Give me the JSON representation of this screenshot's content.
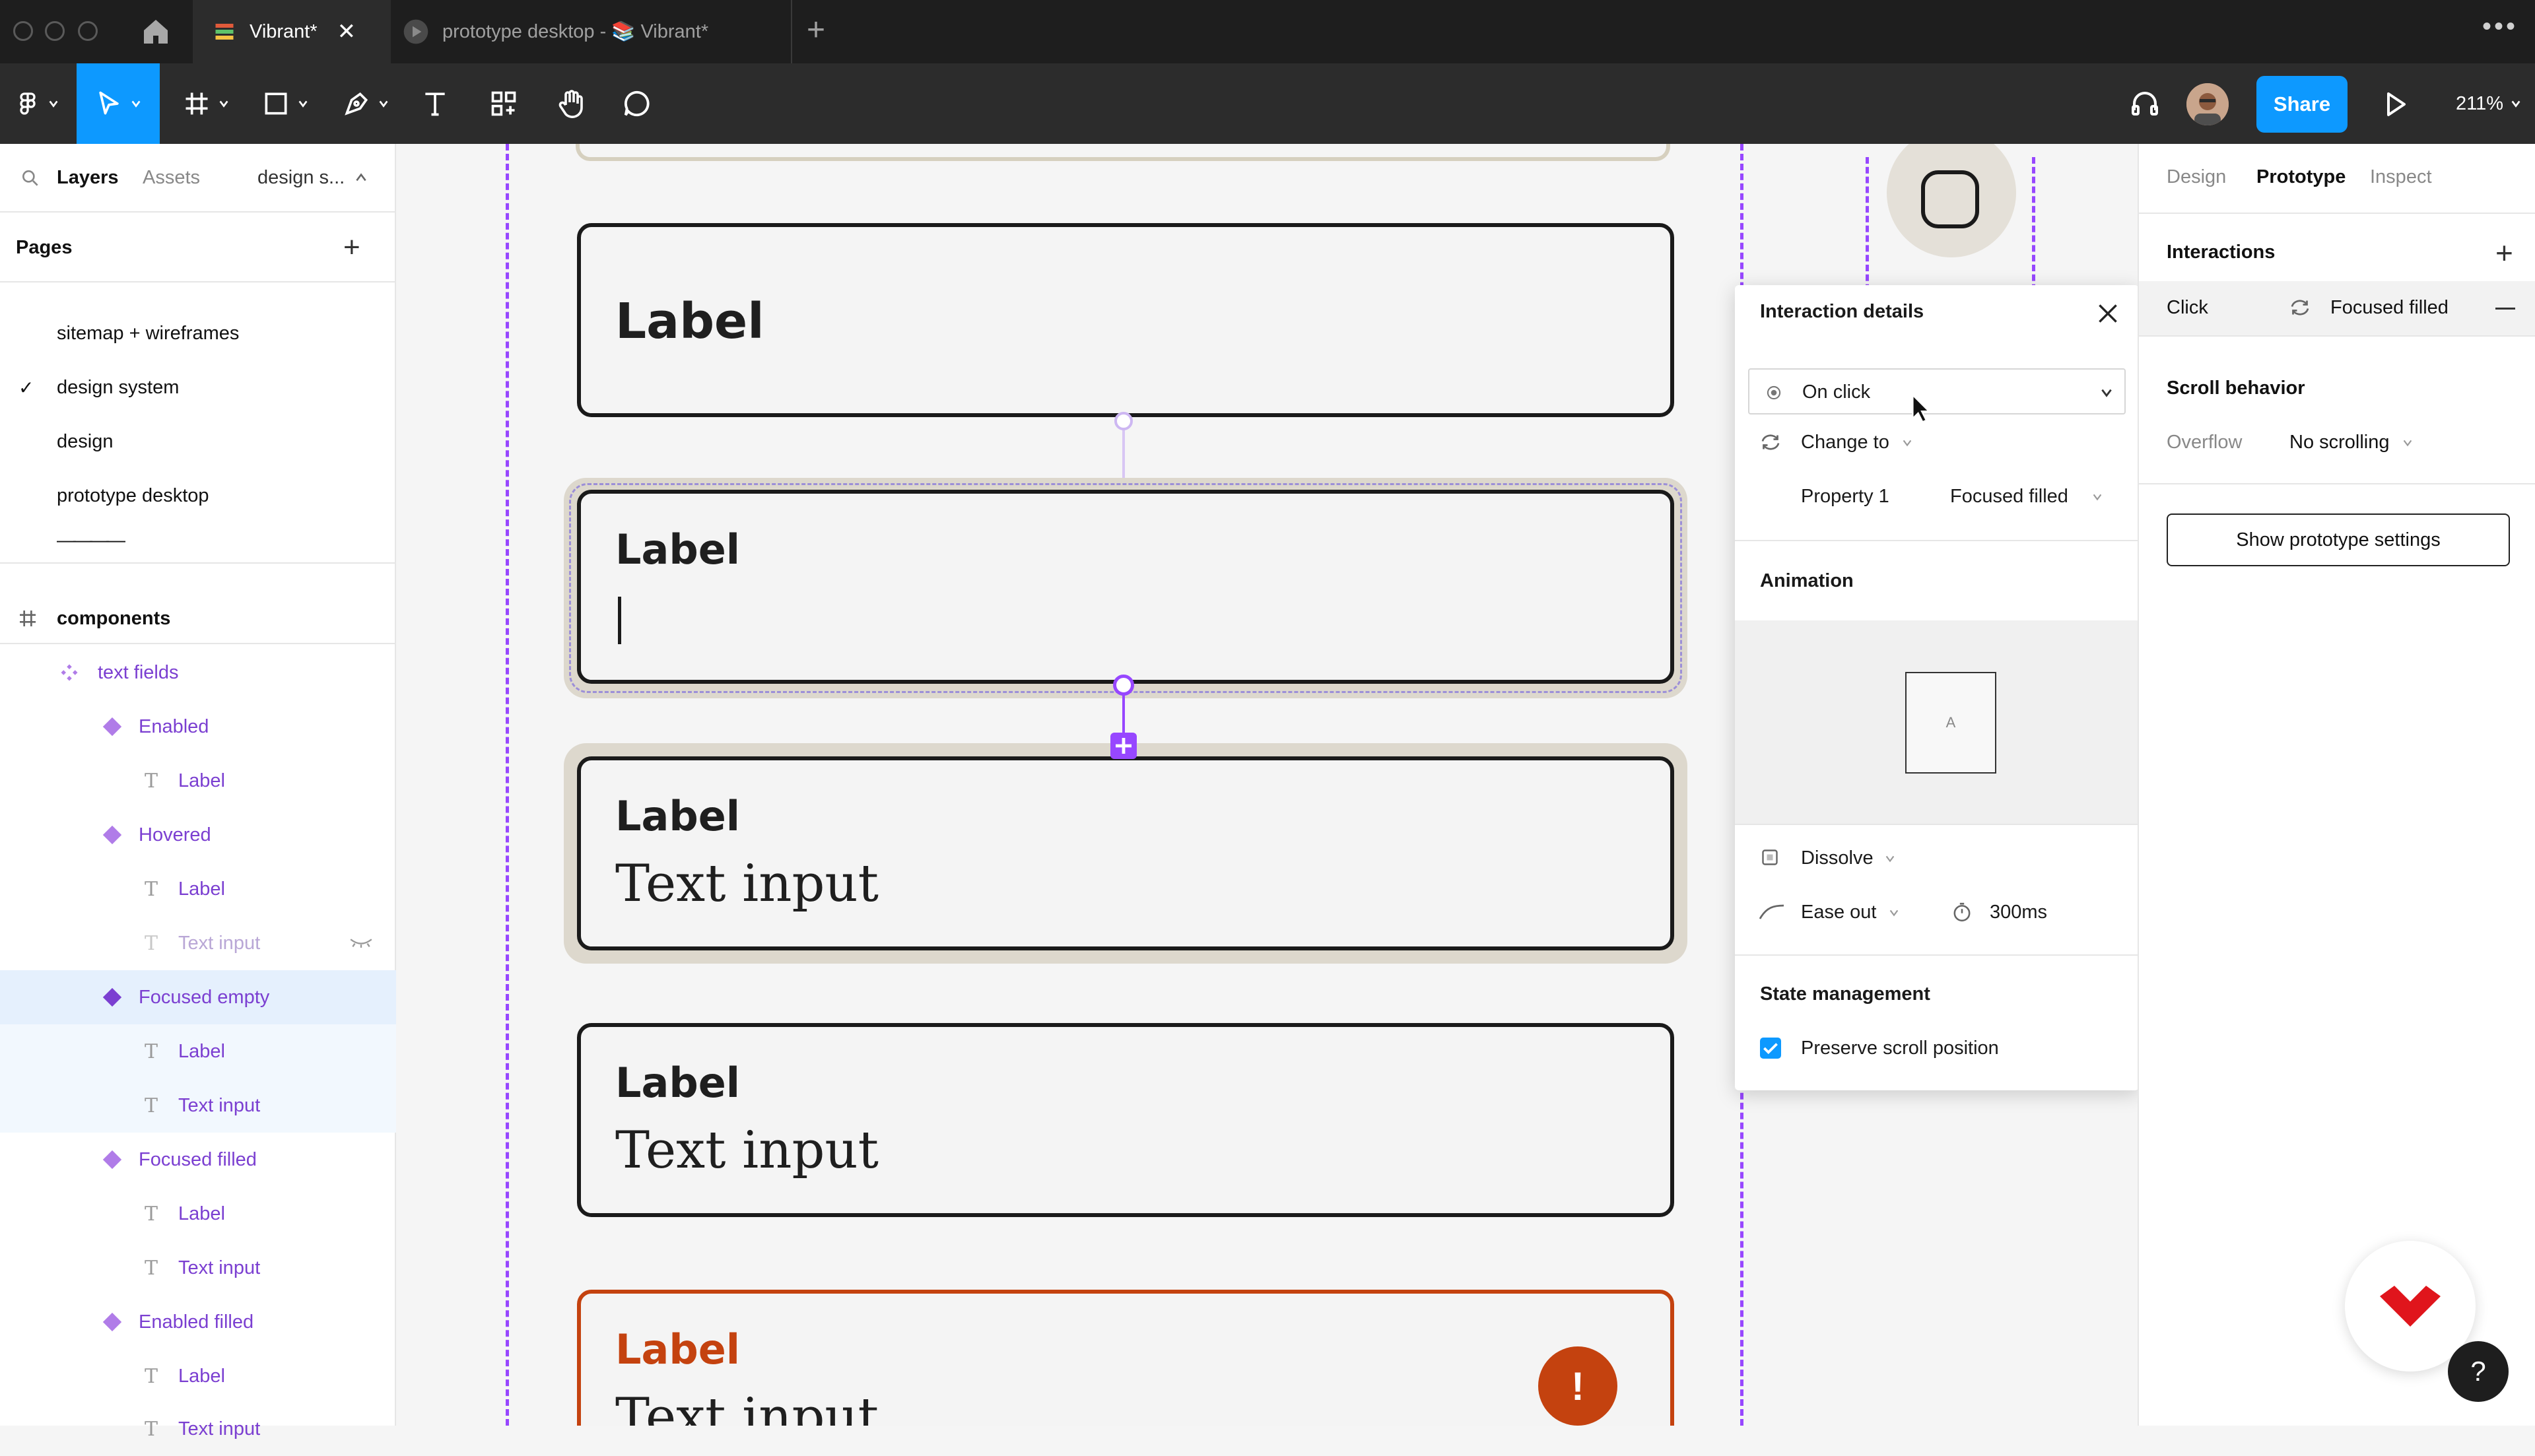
{
  "titlebar": {
    "tabs": [
      {
        "label": "Vibrant*",
        "active": true
      },
      {
        "label": "prototype desktop - 📚 Vibrant*",
        "active": false
      }
    ]
  },
  "toolbar": {
    "share_label": "Share",
    "zoom": "211%"
  },
  "left_panel": {
    "tabs": {
      "layers": "Layers",
      "assets": "Assets",
      "page_selector": "design s..."
    },
    "pages_heading": "Pages",
    "pages": [
      "sitemap + wireframes",
      "design system",
      "design",
      "prototype desktop",
      "————"
    ],
    "current_page": "design system",
    "frame": "components",
    "component_set": "text fields",
    "layers": [
      {
        "kind": "variant",
        "label": "Enabled"
      },
      {
        "kind": "text",
        "label": "Label"
      },
      {
        "kind": "variant",
        "label": "Hovered"
      },
      {
        "kind": "text",
        "label": "Label"
      },
      {
        "kind": "text-hidden",
        "label": "Text input"
      },
      {
        "kind": "variant-selected",
        "label": "Focused empty"
      },
      {
        "kind": "text",
        "label": "Label"
      },
      {
        "kind": "text",
        "label": "Text input"
      },
      {
        "kind": "variant",
        "label": "Focused filled"
      },
      {
        "kind": "text",
        "label": "Label"
      },
      {
        "kind": "text",
        "label": "Text input"
      },
      {
        "kind": "variant",
        "label": "Enabled filled"
      },
      {
        "kind": "text",
        "label": "Label"
      },
      {
        "kind": "text",
        "label": "Text input"
      }
    ]
  },
  "canvas": {
    "cards": [
      {
        "label": "Label"
      },
      {
        "label": "Label",
        "input": "|"
      },
      {
        "label": "Label",
        "input": "Text input"
      },
      {
        "label": "Label",
        "input": "Text input"
      },
      {
        "label": "Label",
        "input": "Text input",
        "error_icon": "!"
      }
    ]
  },
  "popup": {
    "title": "Interaction details",
    "trigger": "On click",
    "action": "Change to",
    "property_name": "Property 1",
    "property_value": "Focused filled",
    "animation_heading": "Animation",
    "preview_letter": "A",
    "animation_type": "Dissolve",
    "easing": "Ease out",
    "duration": "300ms",
    "state_heading": "State management",
    "preserve_scroll": "Preserve scroll position",
    "preserve_scroll_checked": true
  },
  "right_panel": {
    "tabs": {
      "design": "Design",
      "prototype": "Prototype",
      "inspect": "Inspect"
    },
    "interactions_heading": "Interactions",
    "interaction": {
      "trigger": "Click",
      "target": "Focused filled"
    },
    "scroll_heading": "Scroll behavior",
    "overflow_label": "Overflow",
    "overflow_value": "No scrolling",
    "settings_button": "Show prototype settings",
    "help": "?"
  },
  "colors": {
    "accent_purple": "#9747ff",
    "share_blue": "#0d99ff",
    "error_orange": "#c4420f"
  }
}
